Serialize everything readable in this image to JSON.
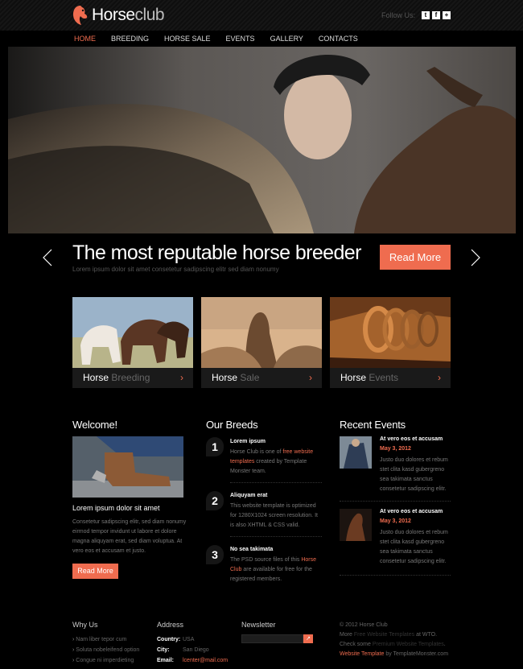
{
  "header": {
    "logo_bold": "Horse",
    "logo_light": "club",
    "follow_label": "Follow Us:",
    "social": [
      {
        "icon": "twitter-icon",
        "glyph": "t"
      },
      {
        "icon": "facebook-icon",
        "glyph": "f"
      },
      {
        "icon": "plus-icon",
        "glyph": "+"
      }
    ]
  },
  "nav": {
    "items": [
      "HOME",
      "BREEDING",
      "HORSE SALE",
      "EVENTS",
      "GALLERY",
      "CONTACTS"
    ],
    "active_index": 0
  },
  "slider": {
    "headline": "The most reputable horse breeder",
    "subtext": "Lorem ipsum dolor sit amet consetetur sadipscing elitr sed diam nonumy",
    "button": "Read More",
    "prev_icon": "chevron-left-icon",
    "next_icon": "chevron-right-icon"
  },
  "features": [
    {
      "title": "Horse",
      "sub": "Breeding"
    },
    {
      "title": "Horse",
      "sub": "Sale"
    },
    {
      "title": "Horse",
      "sub": "Events"
    }
  ],
  "welcome": {
    "title": "Welcome!",
    "heading": "Lorem ipsum dolor sit amet",
    "text": "Consetetur sadipscing elitr, sed diam nonumy eirmod tempor invidunt ut labore et dolore magna aliquyam erat, sed diam voluptua. At vero eos et accusam et justo.",
    "button": "Read More"
  },
  "breeds": {
    "title": "Our Breeds",
    "items": [
      {
        "num": "1",
        "title": "Lorem ipsum",
        "pre": "Horse Club is one of ",
        "link": "free website templates",
        "post": " created by Template Monster team."
      },
      {
        "num": "2",
        "title": "Aliquyam erat",
        "pre": "This website template is optimized for 1280X1024 screen resolution. It is also XHTML & CSS valid.",
        "link": "",
        "post": ""
      },
      {
        "num": "3",
        "title": "No sea takimata",
        "pre": "The PSD source files of this ",
        "link": "Horse Club",
        "post": " are available for free for the registered members."
      }
    ]
  },
  "events": {
    "title": "Recent Events",
    "items": [
      {
        "title": "At vero eos et accusam",
        "date": "May 3, 2012",
        "text": "Justo duo dolores et rebum stet clita kasd gubergreno sea takimata sanctus consetetur sadipscing elitr."
      },
      {
        "title": "At vero eos et accusam",
        "date": "May 3, 2012",
        "text": "Justo duo dolores et rebum stet clita kasd gubergreno sea takimata sanctus consetetur sadipscing elitr."
      }
    ]
  },
  "footer": {
    "why_title": "Why Us",
    "why_items": [
      "Nam liber tepor cum",
      "Soluta nobeleifend option",
      "Congue ni imperdieting"
    ],
    "address_title": "Address",
    "address": [
      {
        "k": "Country:",
        "v": "USA"
      },
      {
        "k": "City:",
        "v": "San Diego"
      },
      {
        "k": "Email:",
        "v": "lcenter@mail.com"
      }
    ],
    "newsletter_title": "Newsletter",
    "newsletter_btn": "↗",
    "copyright": "© 2012 Horse Club",
    "more_pre": "More ",
    "more_link": "Free Website Templates",
    "more_post": " at WTO.",
    "check_pre": "Check some ",
    "check_link": "Premium Website Templates",
    "check_post": ".",
    "wt_link": "Website Template",
    "wt_post": " by TemplateMonster.com"
  },
  "colors": {
    "accent": "#ef6c4f",
    "background": "#000000"
  }
}
